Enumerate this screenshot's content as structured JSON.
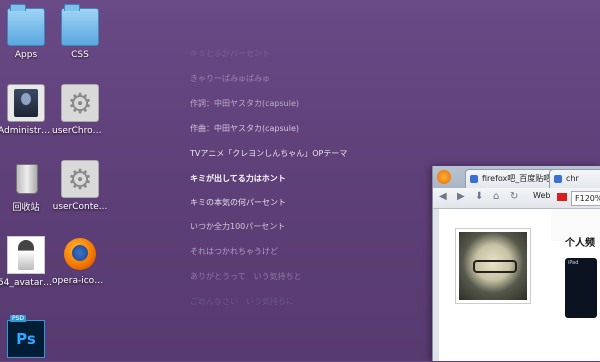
{
  "desktop": {
    "icons": [
      {
        "label": "Apps"
      },
      {
        "label": "CSS"
      },
      {
        "label": "Administra..."
      },
      {
        "label": "userChrom..."
      },
      {
        "label": "回收站"
      },
      {
        "label": "userConte..."
      },
      {
        "label": "54_avatar_..."
      },
      {
        "label": "opera-icon..."
      },
      {
        "label": "PSD",
        "app_label": "Ps"
      }
    ]
  },
  "lyrics": {
    "lines": [
      "キミとふかパーセント",
      "きゃりーぱみゅぱみゅ",
      "作詞：中田ヤスタカ(capsule)",
      "作曲：中田ヤスタカ(capsule)",
      "TVアニメ「クレヨンしんちゃん」OPテーマ",
      "キミが出してる力はホント",
      "キミの本気の何パーセント",
      "いつか全力100パーセント",
      "それはつかれちゃうけど",
      "ありがとうって　いう気持ちと",
      "ごめんなさい　いう気持ちに"
    ],
    "highlight_index": 5,
    "opacities": [
      0.12,
      0.32,
      0.55,
      0.7,
      0.85,
      1.0,
      0.85,
      0.7,
      0.5,
      0.3,
      0.12
    ]
  },
  "browser": {
    "tabs": [
      {
        "label": "firefox吧_百度贴吧",
        "close": "×"
      },
      {
        "label": "chr"
      }
    ],
    "toolbar": {
      "search_engine": "Web",
      "address": "F120%"
    },
    "page": {
      "section_title": "个人频",
      "device_label": "iPad"
    }
  }
}
